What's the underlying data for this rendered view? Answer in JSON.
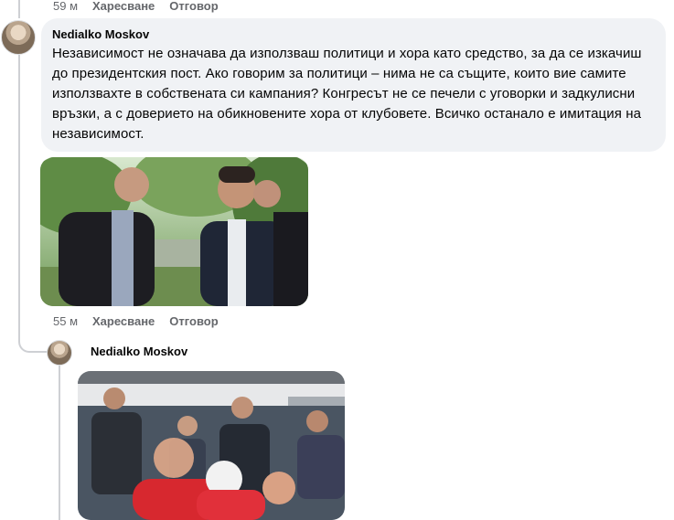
{
  "top_meta": {
    "time": "59 м",
    "like": "Харесване",
    "reply": "Отговор"
  },
  "comment1": {
    "author": "Nedialko Moskov",
    "text": "Независимост не означава да използваш политици и хора като средство, за да се изкачиш до президентския пост. Ако говорим за политици – нима не са същите, които вие самите използвахте в собствената си кампания? Конгресът не се печели с уговорки и задкулисни връзки, а с доверието на обикновените хора от клубовете. Всичко останало е имитация на независимост.",
    "photo_icon": "photo-men-in-suits-park",
    "meta": {
      "time": "55 м",
      "like": "Харесване",
      "reply": "Отговор"
    }
  },
  "reply1": {
    "author": "Nedialko Moskov",
    "photo_icon": "photo-stadium-crowd"
  },
  "colors": {
    "bubble": "#f0f2f5",
    "meta": "#65676b",
    "line": "#ced0d4"
  }
}
